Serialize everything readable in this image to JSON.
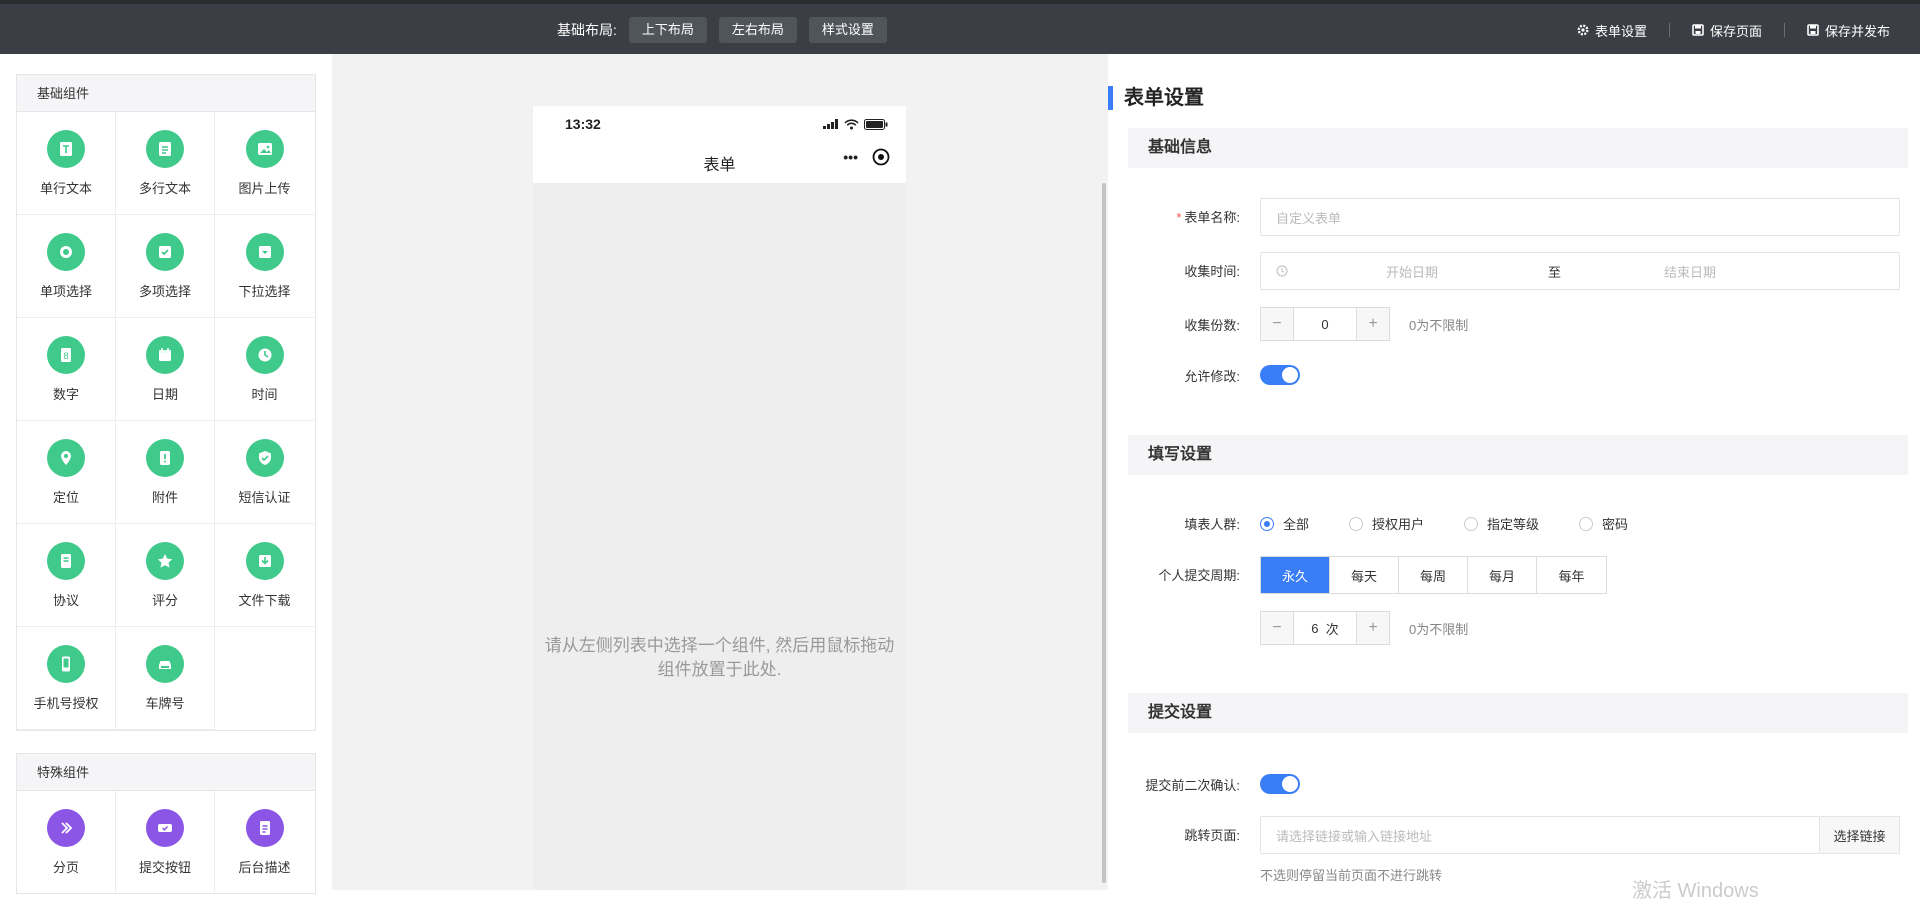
{
  "topbar": {
    "layout_label": "基础布局:",
    "layout_buttons": [
      "上下布局",
      "左右布局",
      "样式设置"
    ],
    "actions": [
      {
        "icon": "gear-icon",
        "label": "表单设置"
      },
      {
        "icon": "save-icon",
        "label": "保存页面"
      },
      {
        "icon": "save-icon",
        "label": "保存并发布"
      }
    ]
  },
  "left": {
    "basic_title": "基础组件",
    "basic_items": [
      {
        "icon": "text-icon",
        "label": "单行文本"
      },
      {
        "icon": "textarea-icon",
        "label": "多行文本"
      },
      {
        "icon": "image-icon",
        "label": "图片上传"
      },
      {
        "icon": "radio-icon",
        "label": "单项选择"
      },
      {
        "icon": "checkbox-icon",
        "label": "多项选择"
      },
      {
        "icon": "dropdown-icon",
        "label": "下拉选择"
      },
      {
        "icon": "number-icon",
        "label": "数字"
      },
      {
        "icon": "calendar-icon",
        "label": "日期"
      },
      {
        "icon": "clock-icon",
        "label": "时间"
      },
      {
        "icon": "location-icon",
        "label": "定位"
      },
      {
        "icon": "attachment-icon",
        "label": "附件"
      },
      {
        "icon": "shield-icon",
        "label": "短信认证"
      },
      {
        "icon": "agreement-icon",
        "label": "协议"
      },
      {
        "icon": "star-icon",
        "label": "评分"
      },
      {
        "icon": "download-icon",
        "label": "文件下载"
      },
      {
        "icon": "phone-icon",
        "label": "手机号授权"
      },
      {
        "icon": "car-icon",
        "label": "车牌号"
      }
    ],
    "special_title": "特殊组件",
    "special_items": [
      {
        "icon": "page-break-icon",
        "label": "分页"
      },
      {
        "icon": "submit-icon",
        "label": "提交按钮"
      },
      {
        "icon": "document-icon",
        "label": "后台描述"
      }
    ]
  },
  "phone": {
    "time": "13:32",
    "title": "表单",
    "more": "•••",
    "empty_hint_line1": "请从左侧列表中选择一个组件, 然后用鼠标拖动",
    "empty_hint_line2": "组件放置于此处."
  },
  "settings": {
    "title": "表单设置",
    "basic": {
      "section_title": "基础信息",
      "name_label": "表单名称:",
      "name_placeholder": "自定义表单",
      "time_label": "收集时间:",
      "start_placeholder": "开始日期",
      "range_sep": "至",
      "end_placeholder": "结束日期",
      "count_label": "收集份数:",
      "count_value": "0",
      "count_hint": "0为不限制",
      "edit_label": "允许修改:",
      "edit_on": true
    },
    "fill": {
      "section_title": "填写设置",
      "group_label": "填表人群:",
      "group_options": [
        "全部",
        "授权用户",
        "指定等级",
        "密码"
      ],
      "group_selected": "全部",
      "period_label": "个人提交周期:",
      "period_options": [
        "永久",
        "每天",
        "每周",
        "每月",
        "每年"
      ],
      "period_selected": "永久",
      "times_value": "6",
      "times_unit": "次",
      "times_hint": "0为不限制"
    },
    "submit": {
      "section_title": "提交设置",
      "confirm_label": "提交前二次确认:",
      "confirm_on": true,
      "jump_label": "跳转页面:",
      "jump_placeholder": "请选择链接或输入链接地址",
      "jump_button": "选择链接",
      "jump_hint": "不选则停留当前页面不进行跳转"
    }
  },
  "watermark": "激活 Windows",
  "colors": {
    "accent": "#3a7ef7",
    "green": "#3fc98a",
    "purple": "#8b56e6",
    "topbar": "#3b3e44"
  }
}
